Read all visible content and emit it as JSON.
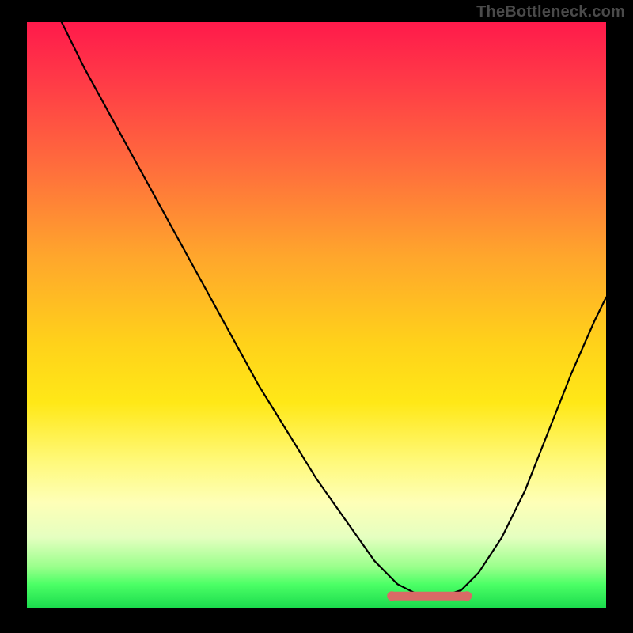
{
  "watermark": "TheBottleneck.com",
  "chart_data": {
    "type": "line",
    "title": "",
    "xlabel": "",
    "ylabel": "",
    "xlim": [
      0,
      100
    ],
    "ylim": [
      0,
      100
    ],
    "grid": false,
    "legend": false,
    "series": [
      {
        "name": "bottleneck-curve",
        "x": [
          6,
          10,
          15,
          20,
          25,
          30,
          35,
          40,
          45,
          50,
          55,
          60,
          62,
          64,
          66,
          68,
          70,
          72,
          75,
          78,
          82,
          86,
          90,
          94,
          98,
          100
        ],
        "y": [
          100,
          92,
          83,
          74,
          65,
          56,
          47,
          38,
          30,
          22,
          15,
          8,
          6,
          4,
          3,
          2,
          2,
          2,
          3,
          6,
          12,
          20,
          30,
          40,
          49,
          53
        ]
      }
    ],
    "highlight": {
      "name": "optimal-range",
      "x_start": 63,
      "x_end": 76,
      "y": 2
    },
    "background_gradient": {
      "top": "#ff1a4b",
      "mid": "#ffd21a",
      "bottom": "#1bdc4d"
    }
  }
}
